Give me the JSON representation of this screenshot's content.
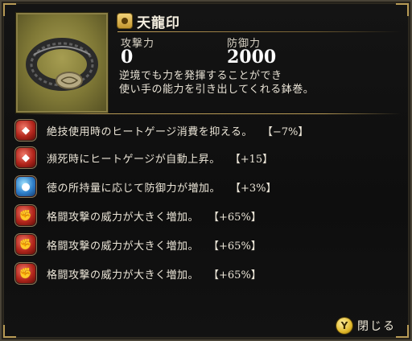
{
  "item": {
    "name": "天龍印",
    "image_icon": "headband-item-image",
    "title_icon": "gold-rarity-icon"
  },
  "stats": {
    "attack_label": "攻撃力",
    "attack_value": "0",
    "defense_label": "防御力",
    "defense_value": "2000"
  },
  "description": {
    "line1": "逆境でも力を発揮することができ",
    "line2": "使い手の能力を引き出してくれる鉢巻。"
  },
  "skills": [
    {
      "icon": "heat-gauge-icon",
      "color": "red",
      "text": "絶技使用時のヒートゲージ消費を抑える。",
      "value": "【−7%】"
    },
    {
      "icon": "heat-gauge-icon",
      "color": "red",
      "text": "瀕死時にヒートゲージが自動上昇。",
      "value": "【+15】"
    },
    {
      "icon": "virtue-icon",
      "color": "blue",
      "text": "徳の所持量に応じて防御力が増加。",
      "value": "【+3%】"
    },
    {
      "icon": "fist-icon",
      "color": "red",
      "text": "格闘攻撃の威力が大きく増加。",
      "value": "【+65%】"
    },
    {
      "icon": "fist-icon",
      "color": "red",
      "text": "格闘攻撃の威力が大きく増加。",
      "value": "【+65%】"
    },
    {
      "icon": "fist-icon",
      "color": "red",
      "text": "格闘攻撃の威力が大きく増加。",
      "value": "【+65%】"
    }
  ],
  "footer": {
    "button_glyph": "Y",
    "close_label": "閉じる"
  },
  "colors": {
    "accent_gold": "#b79a55",
    "skill_red": "#b3261c",
    "skill_blue": "#2f7fc9"
  }
}
